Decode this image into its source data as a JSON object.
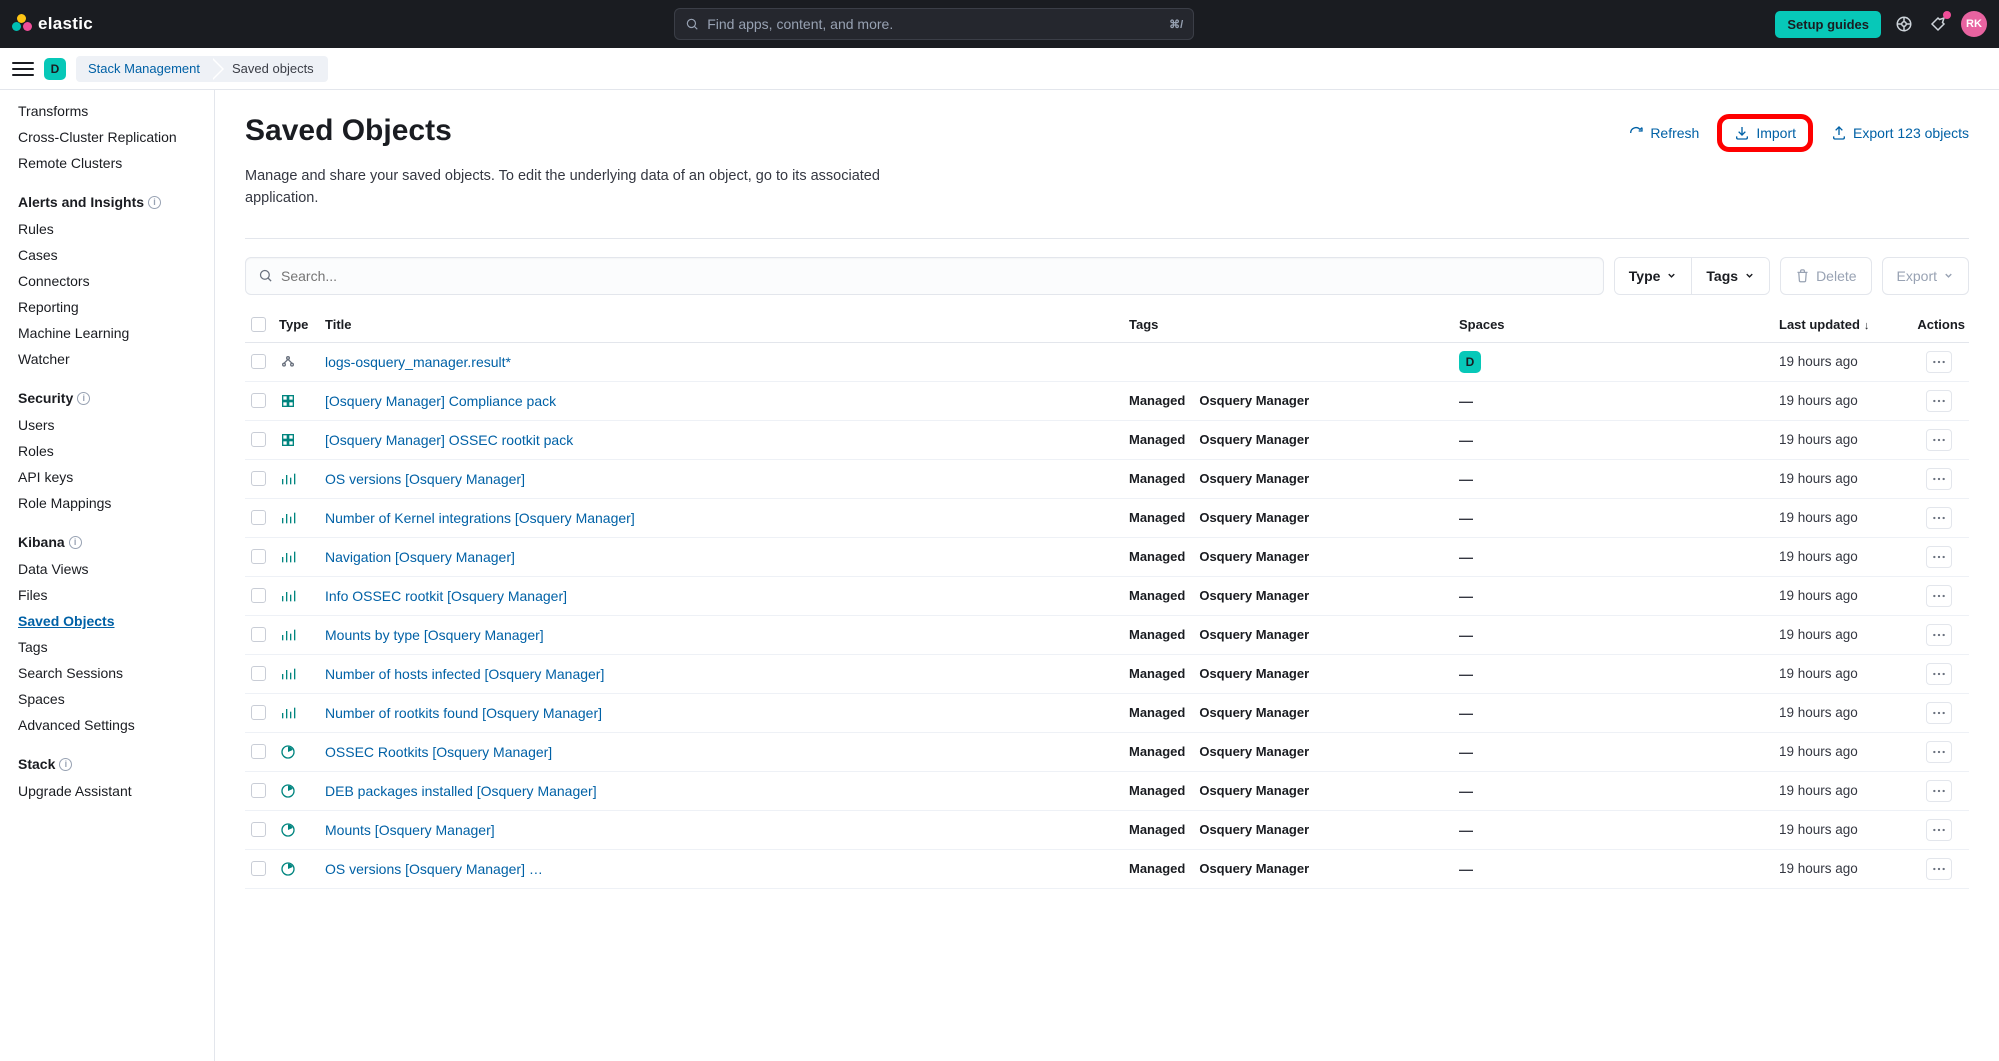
{
  "header": {
    "brand": "elastic",
    "search_placeholder": "Find apps, content, and more.",
    "search_shortcut": "⌘/",
    "setup_label": "Setup guides",
    "avatar": "RK",
    "space_letter": "D"
  },
  "breadcrumb": {
    "item1": "Stack Management",
    "item2": "Saved objects"
  },
  "sidebar": {
    "pre_items": [
      "Transforms",
      "Cross-Cluster Replication",
      "Remote Clusters"
    ],
    "sections": [
      {
        "heading": "Alerts and Insights",
        "items": [
          "Rules",
          "Cases",
          "Connectors",
          "Reporting",
          "Machine Learning",
          "Watcher"
        ]
      },
      {
        "heading": "Security",
        "items": [
          "Users",
          "Roles",
          "API keys",
          "Role Mappings"
        ]
      },
      {
        "heading": "Kibana",
        "items": [
          "Data Views",
          "Files",
          "Saved Objects",
          "Tags",
          "Search Sessions",
          "Spaces",
          "Advanced Settings"
        ]
      },
      {
        "heading": "Stack",
        "items": [
          "Upgrade Assistant"
        ]
      }
    ],
    "active": "Saved Objects"
  },
  "page": {
    "title": "Saved Objects",
    "description": "Manage and share your saved objects. To edit the underlying data of an object, go to its associated application.",
    "refresh_label": "Refresh",
    "import_label": "Import",
    "export_label": "Export 123 objects"
  },
  "toolbar": {
    "search_placeholder": "Search...",
    "type_label": "Type",
    "tags_label": "Tags",
    "delete_label": "Delete",
    "export_label": "Export"
  },
  "table": {
    "headers": {
      "type": "Type",
      "title": "Title",
      "tags": "Tags",
      "spaces": "Spaces",
      "last_updated": "Last updated",
      "actions": "Actions"
    },
    "rows": [
      {
        "icon": "indexpattern",
        "title": "logs-osquery_manager.result*",
        "managed": "",
        "app": "",
        "space": "badge",
        "updated": "19 hours ago"
      },
      {
        "icon": "pack",
        "title": "[Osquery Manager] Compliance pack",
        "managed": "Managed",
        "app": "Osquery Manager",
        "space": "dash",
        "updated": "19 hours ago"
      },
      {
        "icon": "pack",
        "title": "[Osquery Manager] OSSEC rootkit pack",
        "managed": "Managed",
        "app": "Osquery Manager",
        "space": "dash",
        "updated": "19 hours ago"
      },
      {
        "icon": "vis",
        "title": "OS versions [Osquery Manager]",
        "managed": "Managed",
        "app": "Osquery Manager",
        "space": "dash",
        "updated": "19 hours ago"
      },
      {
        "icon": "vis",
        "title": "Number of Kernel integrations [Osquery Manager]",
        "managed": "Managed",
        "app": "Osquery Manager",
        "space": "dash",
        "updated": "19 hours ago"
      },
      {
        "icon": "vis",
        "title": "Navigation [Osquery Manager]",
        "managed": "Managed",
        "app": "Osquery Manager",
        "space": "dash",
        "updated": "19 hours ago"
      },
      {
        "icon": "vis",
        "title": "Info OSSEC rootkit [Osquery Manager]",
        "managed": "Managed",
        "app": "Osquery Manager",
        "space": "dash",
        "updated": "19 hours ago"
      },
      {
        "icon": "vis",
        "title": "Mounts by type [Osquery Manager]",
        "managed": "Managed",
        "app": "Osquery Manager",
        "space": "dash",
        "updated": "19 hours ago"
      },
      {
        "icon": "vis",
        "title": "Number of hosts infected [Osquery Manager]",
        "managed": "Managed",
        "app": "Osquery Manager",
        "space": "dash",
        "updated": "19 hours ago"
      },
      {
        "icon": "vis",
        "title": "Number of rootkits found [Osquery Manager]",
        "managed": "Managed",
        "app": "Osquery Manager",
        "space": "dash",
        "updated": "19 hours ago"
      },
      {
        "icon": "dash",
        "title": "OSSEC Rootkits [Osquery Manager]",
        "managed": "Managed",
        "app": "Osquery Manager",
        "space": "dash",
        "updated": "19 hours ago"
      },
      {
        "icon": "dash",
        "title": "DEB packages installed [Osquery Manager]",
        "managed": "Managed",
        "app": "Osquery Manager",
        "space": "dash",
        "updated": "19 hours ago"
      },
      {
        "icon": "dash",
        "title": "Mounts [Osquery Manager]",
        "managed": "Managed",
        "app": "Osquery Manager",
        "space": "dash",
        "updated": "19 hours ago"
      },
      {
        "icon": "dash",
        "title": "OS versions [Osquery Manager] …",
        "managed": "Managed",
        "app": "Osquery Manager",
        "space": "dash",
        "updated": "19 hours ago"
      }
    ]
  }
}
